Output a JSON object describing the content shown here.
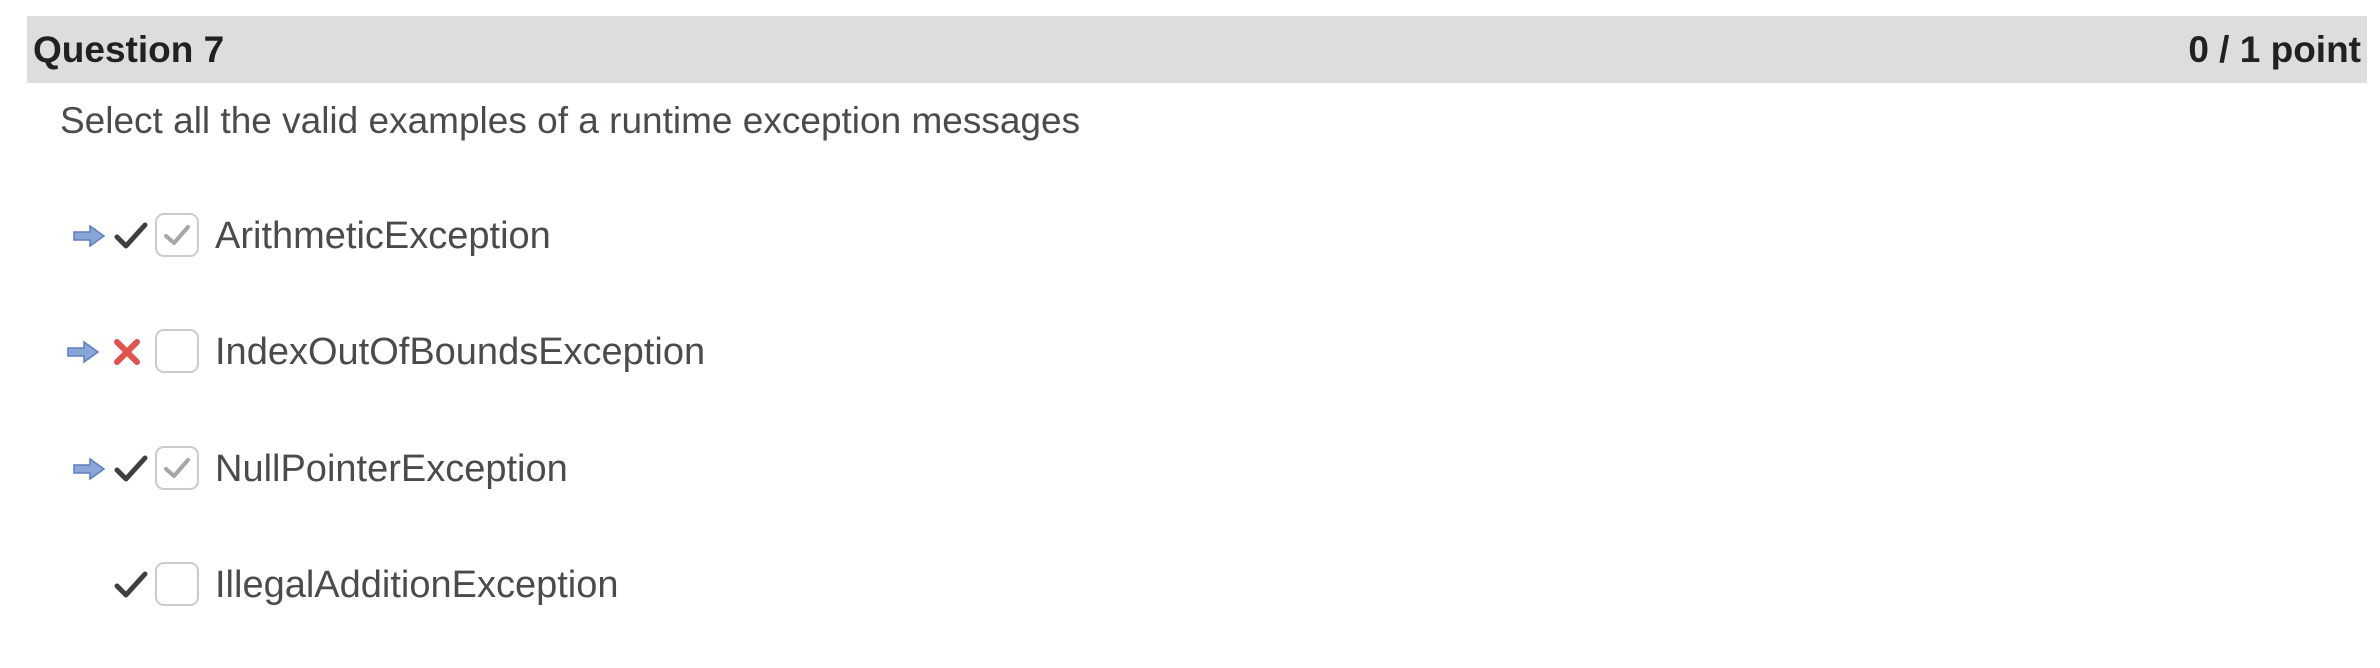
{
  "question": {
    "title": "Question 7",
    "score": "0 / 1 point",
    "prompt": "Select all the valid examples of a runtime exception messages"
  },
  "options": [
    {
      "label": "ArithmeticException",
      "user_selected": true,
      "correctness_marker": "checkmark-icon",
      "checked": true
    },
    {
      "label": "IndexOutOfBoundsException",
      "user_selected": true,
      "correctness_marker": "cross-icon",
      "checked": false
    },
    {
      "label": "NullPointerException",
      "user_selected": true,
      "correctness_marker": "checkmark-icon",
      "checked": true
    },
    {
      "label": "IllegalAdditionException",
      "user_selected": false,
      "correctness_marker": "checkmark-icon",
      "checked": false
    }
  ],
  "colors": {
    "header_bg": "#dddddd",
    "arrow": "#7f9ed6",
    "checkmark": "#3d3f41",
    "cross": "#e0524e",
    "box_check": "#a4a7aa"
  }
}
